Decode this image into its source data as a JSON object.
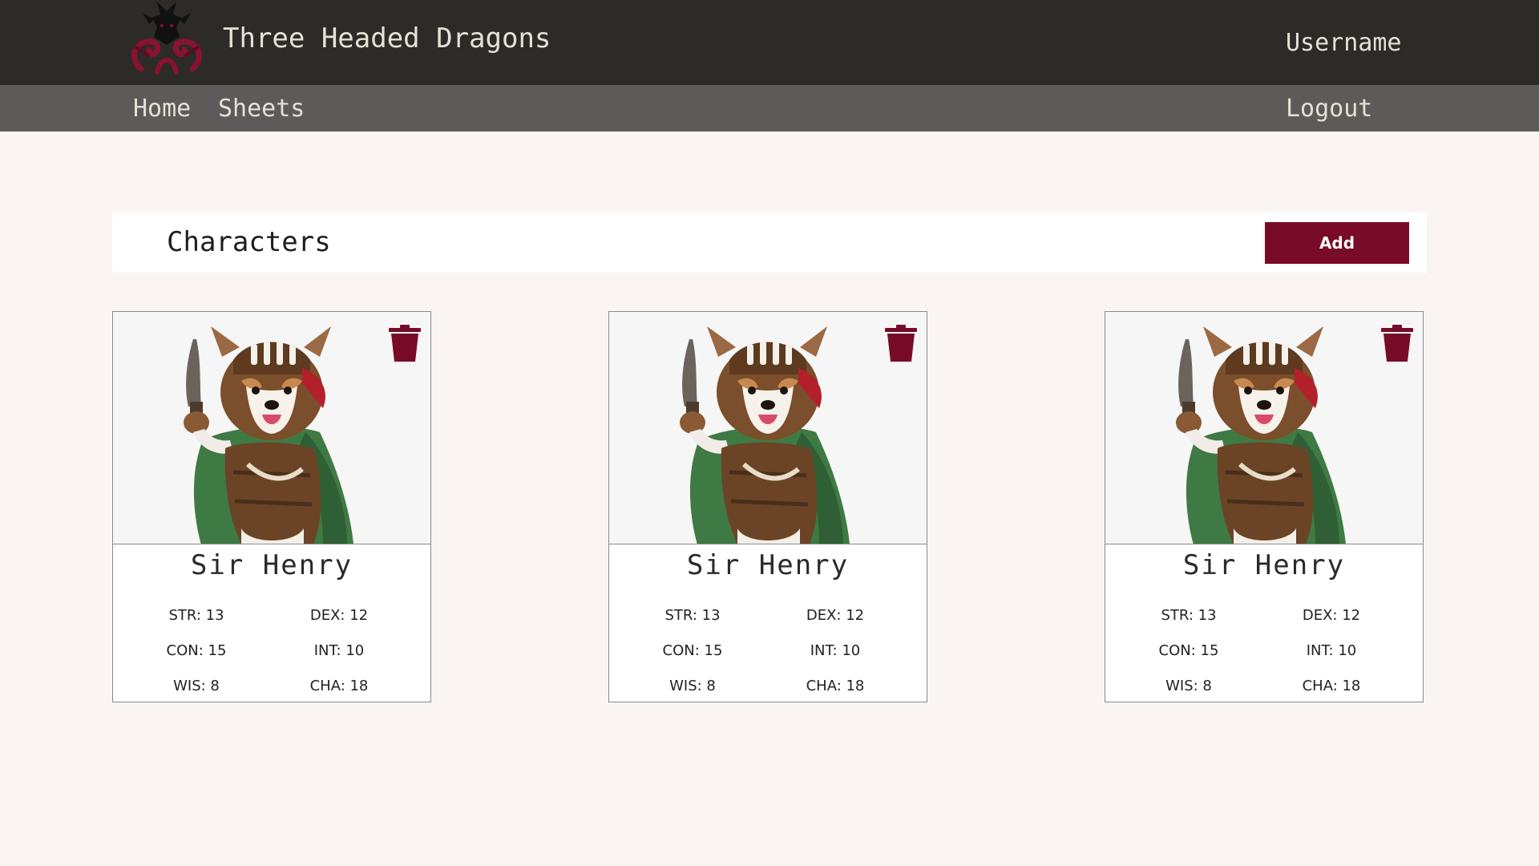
{
  "header": {
    "site_title": "Three Headed Dragons",
    "username": "Username",
    "logo_icon": "three-headed-dragon-logo",
    "accent_color": "#780c28"
  },
  "nav": {
    "home": "Home",
    "sheets": "Sheets",
    "logout": "Logout"
  },
  "characters_section": {
    "title": "Characters",
    "add_label": "Add"
  },
  "cards": [
    {
      "name": "Sir Henry",
      "image_icon": "corgi-adventurer-portrait",
      "delete_icon": "trash-icon",
      "stats": {
        "str": "STR: 13",
        "dex": "DEX: 12",
        "con": "CON: 15",
        "int": "INT: 10",
        "wis": "WIS: 8",
        "cha": "CHA: 18"
      }
    },
    {
      "name": "Sir Henry",
      "image_icon": "corgi-adventurer-portrait",
      "delete_icon": "trash-icon",
      "stats": {
        "str": "STR: 13",
        "dex": "DEX: 12",
        "con": "CON: 15",
        "int": "INT: 10",
        "wis": "WIS: 8",
        "cha": "CHA: 18"
      }
    },
    {
      "name": "Sir Henry",
      "image_icon": "corgi-adventurer-portrait",
      "delete_icon": "trash-icon",
      "stats": {
        "str": "STR: 13",
        "dex": "DEX: 12",
        "con": "CON: 15",
        "int": "INT: 10",
        "wis": "WIS: 8",
        "cha": "CHA: 18"
      }
    }
  ]
}
